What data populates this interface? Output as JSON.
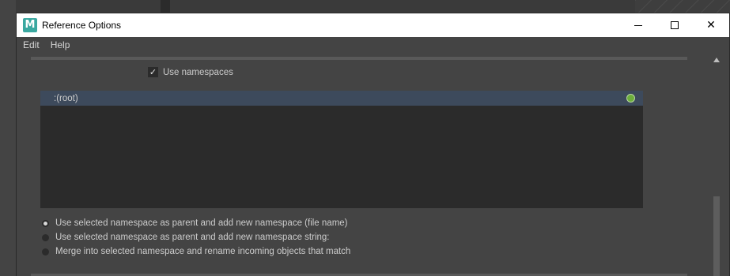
{
  "window": {
    "title": "Reference Options",
    "icon_letter": "M",
    "controls": {
      "minimize": "—",
      "maximize": "☐",
      "close": "✕"
    }
  },
  "menu": [
    {
      "label": "Edit"
    },
    {
      "label": "Help"
    }
  ],
  "namespace": {
    "use_namespaces_label": "Use namespaces",
    "use_namespaces_checked": true,
    "checkmark": "✓",
    "list_items": [
      {
        "label": ":(root)",
        "status_color": "#6cae3c"
      }
    ]
  },
  "options": [
    {
      "label": "Use selected namespace as parent and add new namespace (file name)",
      "selected": true
    },
    {
      "label": "Use selected namespace as parent and add new namespace string:",
      "selected": false
    },
    {
      "label": "Merge into selected namespace and rename incoming objects that match",
      "selected": false
    }
  ],
  "colors": {
    "dialog_bg": "#444444",
    "list_bg": "#2b2b2b",
    "selected_row": "#3d4a5c",
    "status_dot": "#6cae3c"
  }
}
